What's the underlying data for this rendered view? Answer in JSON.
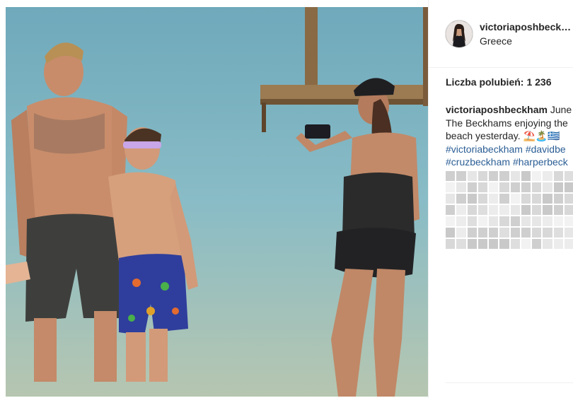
{
  "post": {
    "username": "victoriaposhbeckham",
    "location": "Greece",
    "likes_label": "Liczba polubień:",
    "likes_count": "1 236",
    "caption": {
      "line1_user": "victoriaposhbeckham",
      "line1_date": "June",
      "line2": "The Beckhams enjoying the",
      "line3": "beach yesterday. ⛱️🏝️🇬🇷",
      "hashtag1": "#victoriabeckham",
      "hashtag2": "#davidbe",
      "hashtag3": "#cruzbeckham",
      "hashtag4": "#harperbeck"
    }
  },
  "colors": {
    "text": "#262626",
    "hashtag": "#2b5e95",
    "divider": "#efefef",
    "water": "#7fb6c4"
  },
  "icons": {
    "avatar": "profile-avatar"
  }
}
